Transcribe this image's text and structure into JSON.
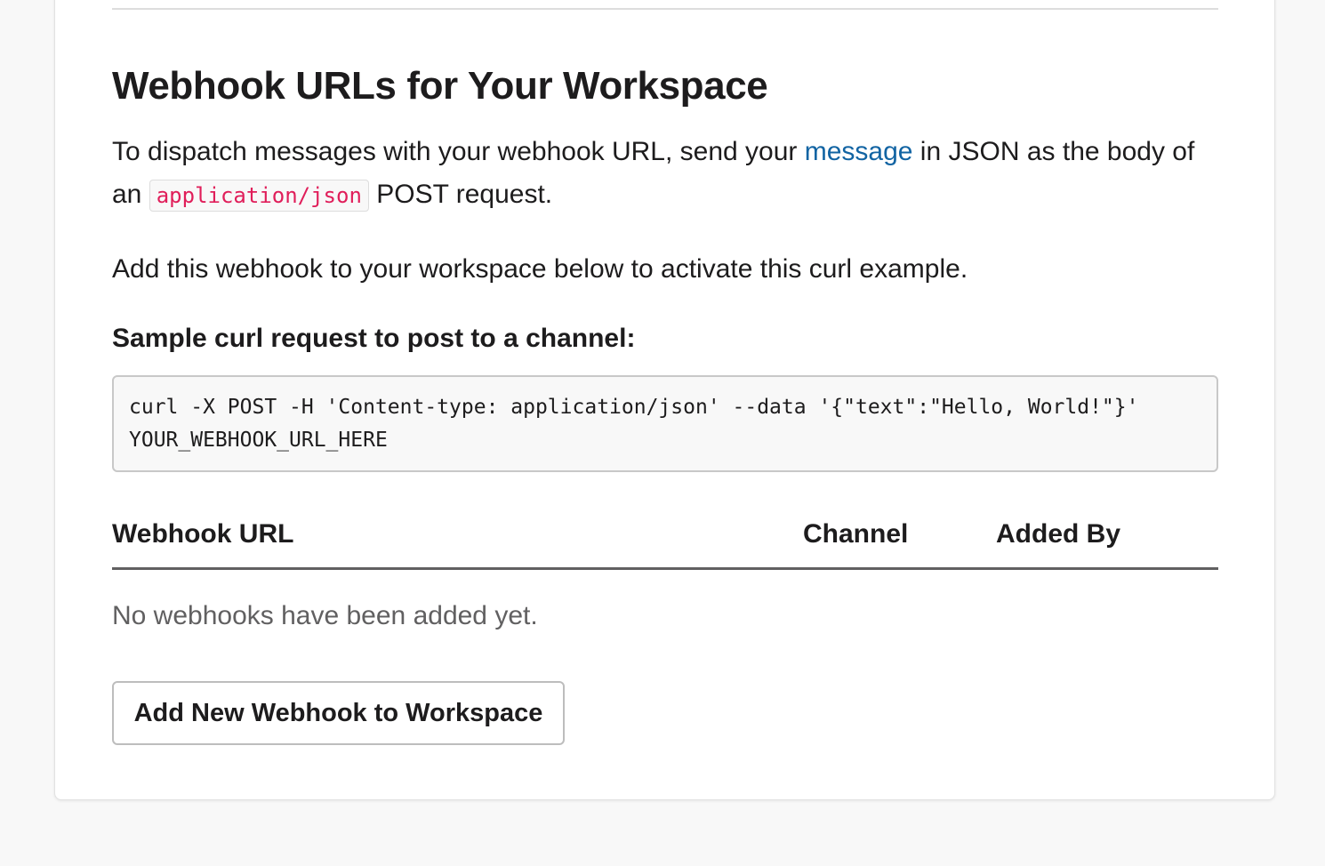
{
  "section": {
    "title": "Webhook URLs for Your Workspace",
    "description": {
      "part1": "To dispatch messages with your webhook URL, send your ",
      "link": "message",
      "part2": " in JSON as the body of an ",
      "code": "application/json",
      "part3": " POST request."
    },
    "activate_text": "Add this webhook to your workspace below to activate this curl example.",
    "sample_label": "Sample curl request to post to a channel:",
    "curl_example": "curl -X POST -H 'Content-type: application/json' --data '{\"text\":\"Hello, World!\"}' YOUR_WEBHOOK_URL_HERE"
  },
  "table": {
    "columns": [
      "Webhook URL",
      "Channel",
      "Added By"
    ],
    "empty_message": "No webhooks have been added yet."
  },
  "actions": {
    "add_button_label": "Add New Webhook to Workspace"
  },
  "colors": {
    "link": "#1264a3",
    "inline_code": "#e01e5a",
    "page_background": "#f8f8f8"
  }
}
